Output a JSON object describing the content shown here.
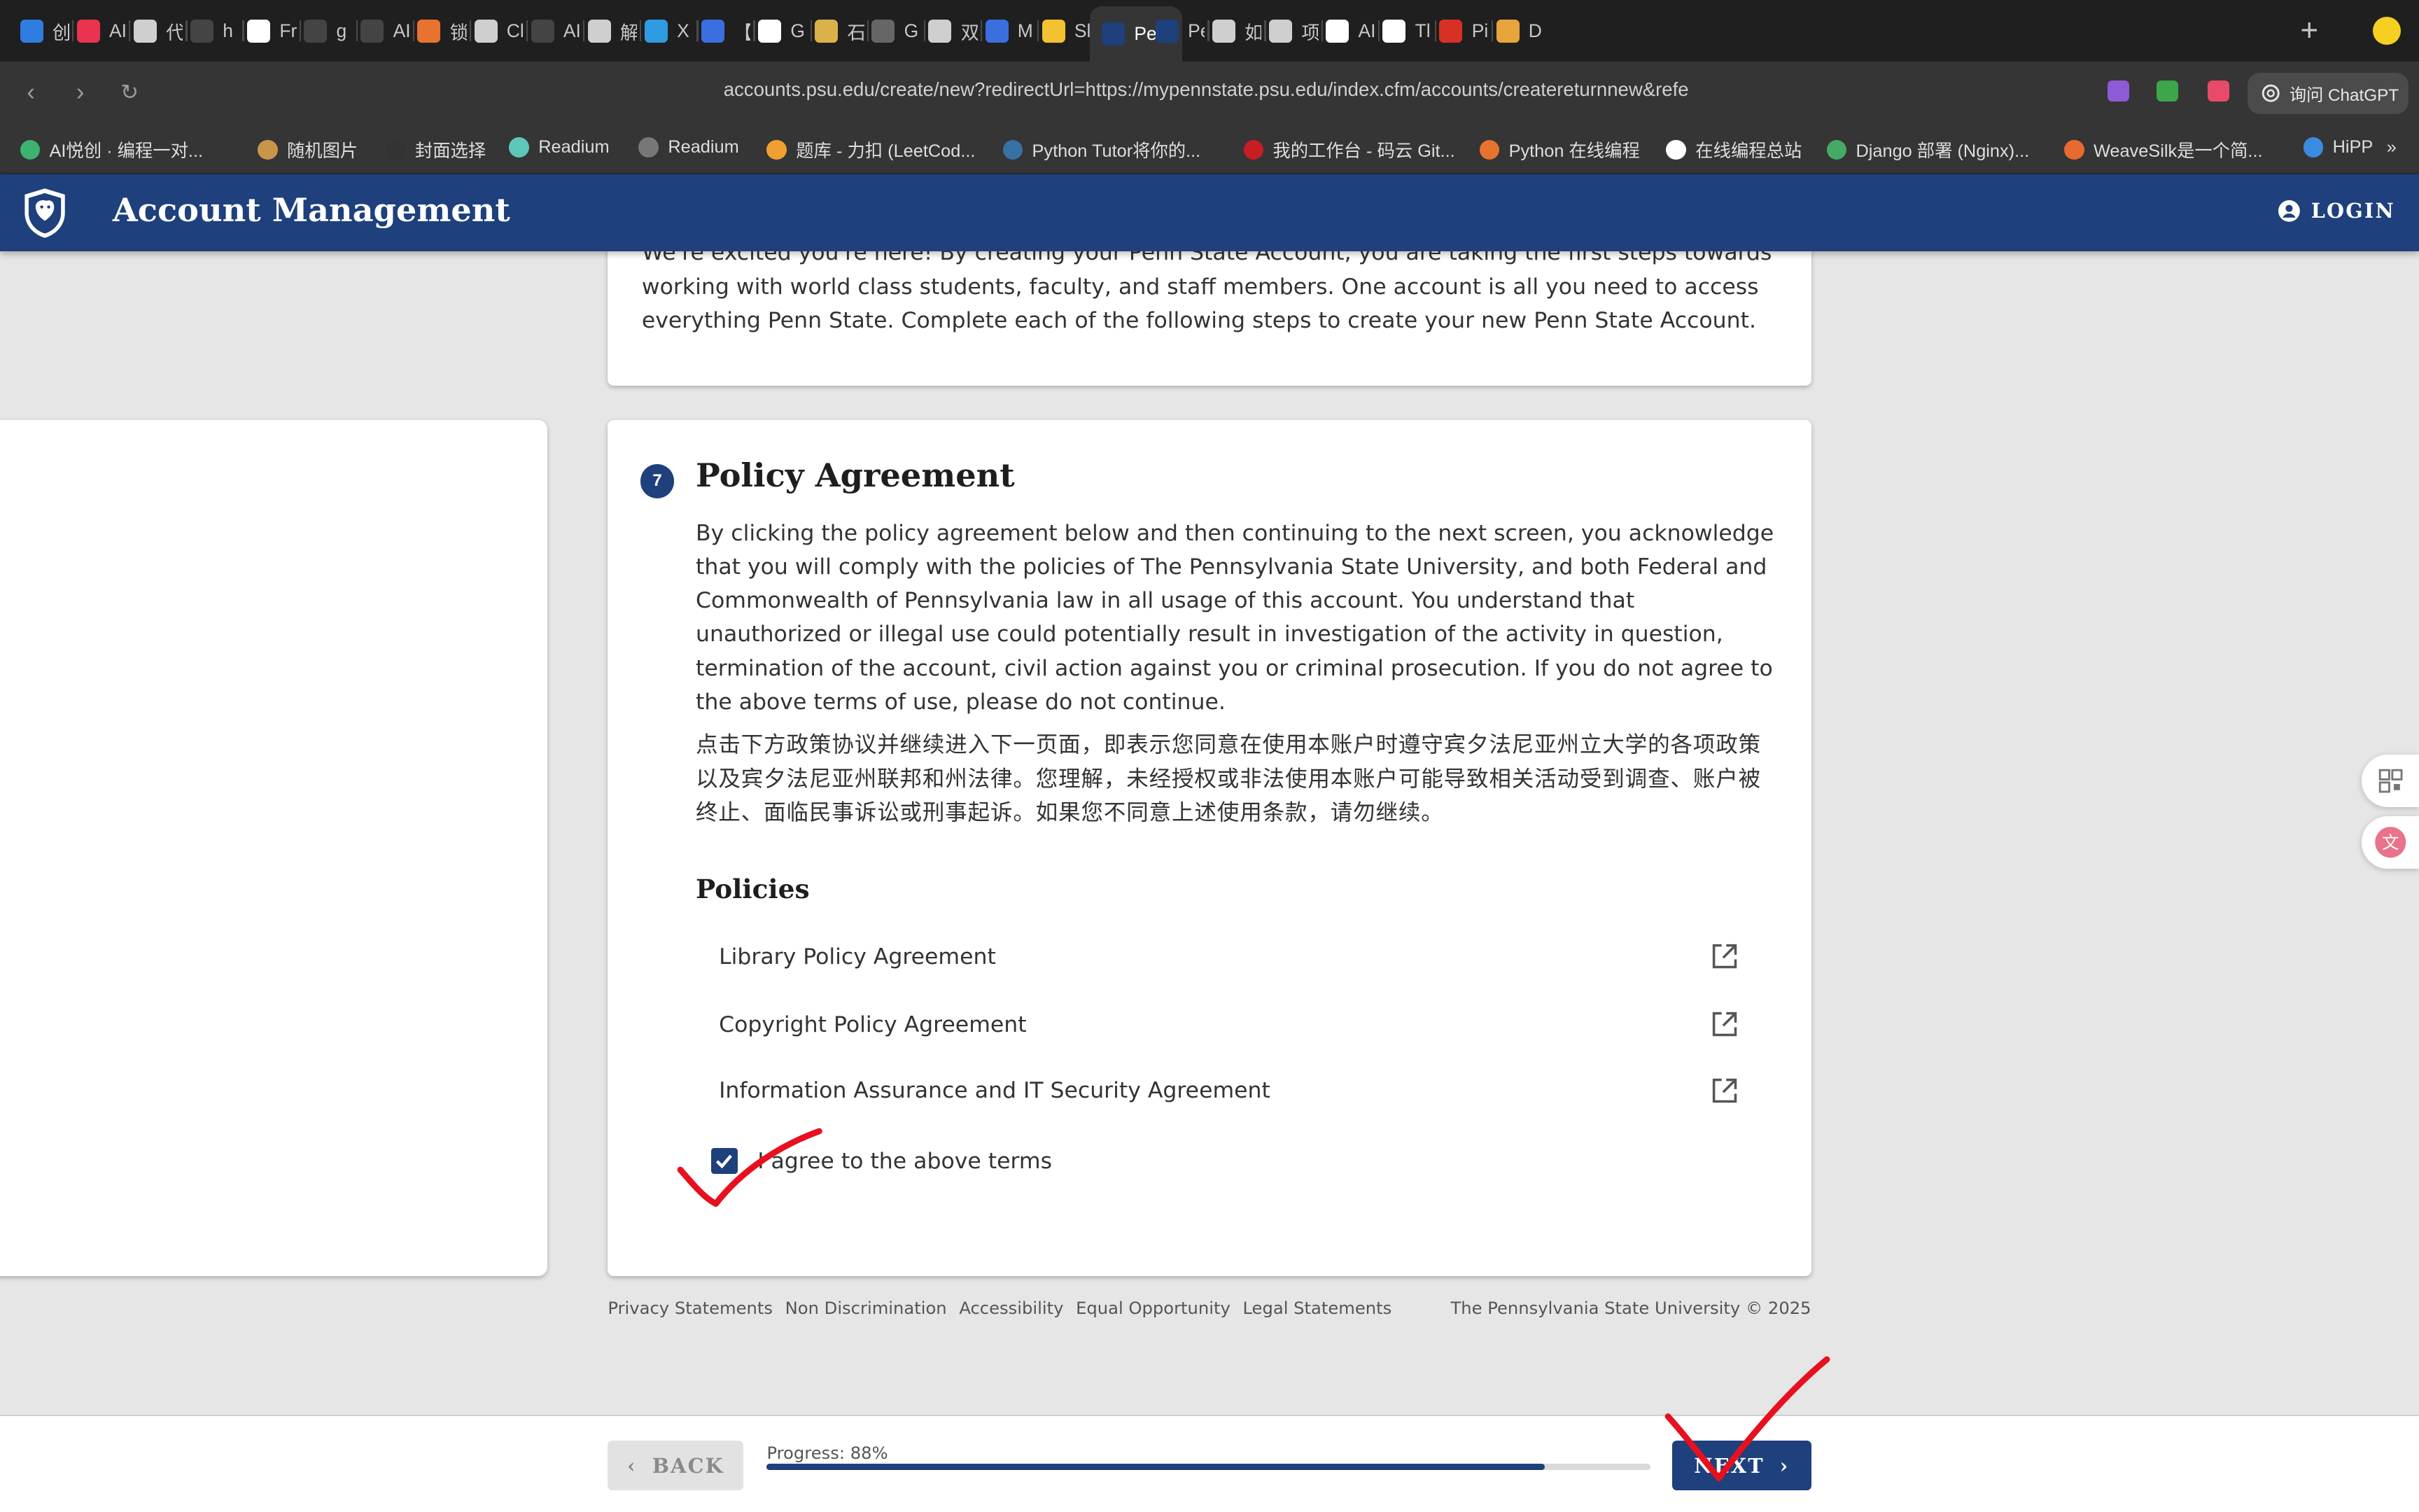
{
  "browser": {
    "tabs": [
      {
        "label": "创",
        "color": "#2f7de1"
      },
      {
        "label": "AI",
        "color": "#e8344e"
      },
      {
        "label": "代",
        "color": "#cfcfcf"
      },
      {
        "label": "h",
        "color": "#444444"
      },
      {
        "label": "Fr",
        "color": "#ffffff"
      },
      {
        "label": "g",
        "color": "#444444"
      },
      {
        "label": "AI",
        "color": "#444444"
      },
      {
        "label": "锁",
        "color": "#e8732f"
      },
      {
        "label": "Cl",
        "color": "#cfcfcf"
      },
      {
        "label": "AI",
        "color": "#444444"
      },
      {
        "label": "解",
        "color": "#cfcfcf"
      },
      {
        "label": "X",
        "color": "#2f9be1"
      },
      {
        "label": "【",
        "color": "#3b6fe0"
      },
      {
        "label": "G",
        "color": "#ffffff"
      },
      {
        "label": "石",
        "color": "#d9b24a"
      },
      {
        "label": "G",
        "color": "#666666"
      },
      {
        "label": "双",
        "color": "#cfcfcf"
      },
      {
        "label": "M",
        "color": "#3b6fe0"
      },
      {
        "label": "Sl",
        "color": "#f2c230"
      },
      {
        "label": "Pen",
        "color": "#1e407c",
        "active": true
      },
      {
        "label": "Pe",
        "color": "#1e407c"
      },
      {
        "label": "如",
        "color": "#cfcfcf"
      },
      {
        "label": "项",
        "color": "#cfcfcf"
      },
      {
        "label": "AI",
        "color": "#ffffff"
      },
      {
        "label": "Tl",
        "color": "#ffffff"
      },
      {
        "label": "Pi",
        "color": "#d93025"
      },
      {
        "label": "D",
        "color": "#e8a53b"
      }
    ],
    "new_tab_symbol": "+",
    "url": "accounts.psu.edu/create/new?redirectUrl=https://mypennstate.psu.edu/index.cfm/accounts/createreturnnew&refe",
    "ask_chatgpt_label": "询问 ChatGPT",
    "bookmarks": [
      {
        "label": "AI悦创 · 编程一对...",
        "color": "#3cb371"
      },
      {
        "label": "随机图片",
        "color": "#c8964a"
      },
      {
        "label": "封面选择",
        "color": "#333333"
      },
      {
        "label": "Readium",
        "color": "#5ec8b8"
      },
      {
        "label": "Readium",
        "color": "#777777"
      },
      {
        "label": "题库 - 力扣 (LeetCod...",
        "color": "#f0a030"
      },
      {
        "label": "Python Tutor将你的...",
        "color": "#3772a4"
      },
      {
        "label": "我的工作台 - 码云 Git...",
        "color": "#c71d23"
      },
      {
        "label": "Python 在线编程",
        "color": "#e8732f"
      },
      {
        "label": "在线编程总站",
        "color": "#ffffff"
      },
      {
        "label": "Django 部署 (Nginx)...",
        "color": "#44aa66"
      },
      {
        "label": "WeaveSilk是一个简...",
        "color": "#e86a30"
      },
      {
        "label": "HiPP",
        "color": "#3b8be0"
      }
    ]
  },
  "header": {
    "title": "Account Management",
    "login_label": "LOGIN",
    "brand_color": "#1e407c"
  },
  "intro": {
    "text": "We're excited you're here! By creating your Penn State Account, you are taking the first steps towards working with world class students, faculty, and staff members. One account is all you need to access everything Penn State. Complete each of the following steps to create your new Penn State Account."
  },
  "policy": {
    "step_number": "7",
    "title": "Policy Agreement",
    "text_en": "By clicking the policy agreement below and then continuing to the next screen, you acknowledge that you will comply with the policies of The Pennsylvania State University, and both Federal and Commonwealth of Pennsylvania law in all usage of this account. You understand that unauthorized or illegal use could potentially result in investigation of the activity in question, termination of the account, civil action against you or criminal prosecution. If you do not agree to the above terms of use, please do not continue.",
    "text_cn": "点击下方政策协议并继续进入下一页面，即表示您同意在使用本账户时遵守宾夕法尼亚州立大学的各项政策以及宾夕法尼亚州联邦和州法律。您理解，未经授权或非法使用本账户可能导致相关活动受到调查、账户被终止、面临民事诉讼或刑事起诉。如果您不同意上述使用条款，请勿继续。",
    "policies_heading": "Policies",
    "policies": [
      "Library Policy Agreement",
      "Copyright Policy Agreement",
      "Information Assurance and IT Security Agreement"
    ],
    "agree_label": "I agree to the above terms",
    "agree_checked": true
  },
  "footer": {
    "links": [
      "Privacy Statements",
      "Non Discrimination",
      "Accessibility",
      "Equal Opportunity",
      "Legal Statements"
    ],
    "copyright": "The Pennsylvania State University © 2025"
  },
  "navigation": {
    "back_label": "BACK",
    "next_label": "NEXT",
    "progress_label": "Progress: 88%",
    "progress_fraction": 0.88
  },
  "annotation_color": "#e8101e"
}
